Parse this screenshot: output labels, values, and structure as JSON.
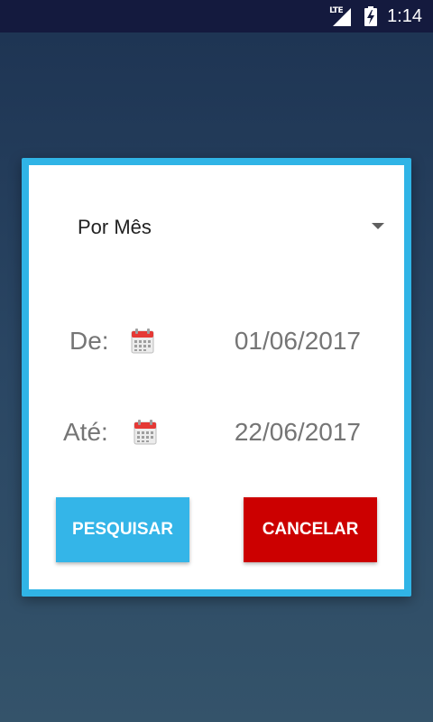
{
  "status_bar": {
    "network_label": "LTE",
    "time": "1:14"
  },
  "dialog": {
    "period_select": {
      "selected": "Por Mês"
    },
    "from": {
      "label": "De:",
      "value": "01/06/2017"
    },
    "to": {
      "label": "Até:",
      "value": "22/06/2017"
    },
    "buttons": {
      "search_label": "PESQUISAR",
      "cancel_label": "CANCELAR"
    }
  },
  "colors": {
    "dialog_border": "#30b4e6",
    "search_button": "#34b5e8",
    "cancel_button": "#cc0000",
    "status_bar": "#141a3e"
  },
  "icons": {
    "status": [
      "lte-signal-icon",
      "battery-charging-icon"
    ],
    "date_pickers": [
      "calendar-icon",
      "calendar-icon"
    ],
    "select": "dropdown-arrow-icon"
  }
}
